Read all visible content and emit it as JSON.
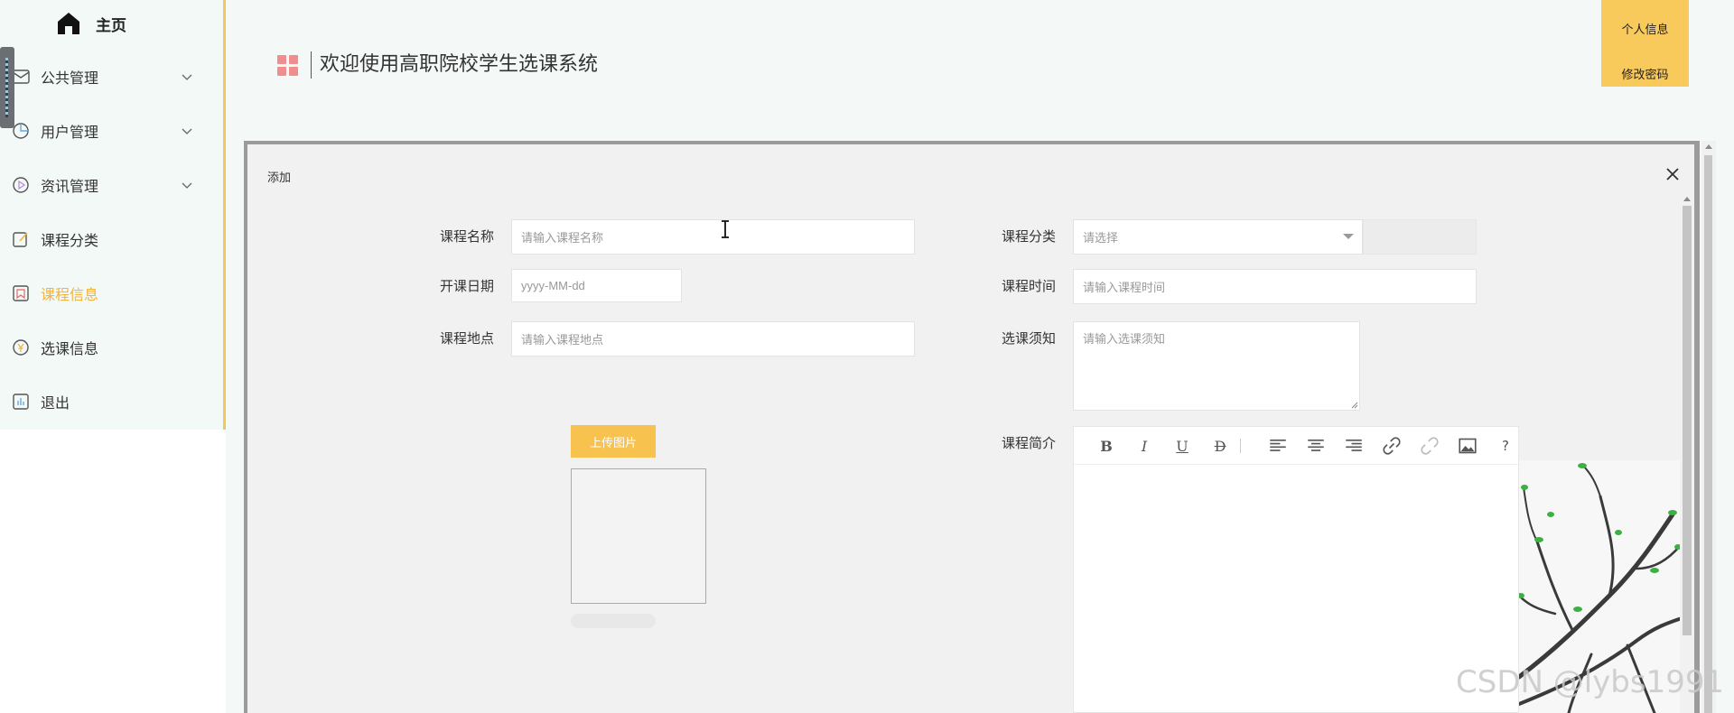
{
  "sidebar": {
    "home_label": "主页",
    "items": [
      {
        "label": "公共管理",
        "icon": "mail-icon"
      },
      {
        "label": "用户管理",
        "icon": "pie-chart-icon"
      },
      {
        "label": "资讯管理",
        "icon": "play-circle-icon"
      },
      {
        "label": "课程分类",
        "icon": "edit-icon"
      },
      {
        "label": "课程信息",
        "icon": "bookmark-icon",
        "active": true
      },
      {
        "label": "选课信息",
        "icon": "yen-circle-icon"
      },
      {
        "label": "退出",
        "icon": "bar-chart-icon"
      }
    ]
  },
  "header": {
    "title": "欢迎使用高职院校学生选课系统",
    "profile_label": "个人信息",
    "change_password_label": "修改密码"
  },
  "modal": {
    "title": "添加",
    "fields": {
      "course_name": {
        "label": "课程名称",
        "placeholder": "请输入课程名称"
      },
      "course_category": {
        "label": "课程分类",
        "placeholder": "请选择"
      },
      "start_date": {
        "label": "开课日期",
        "placeholder": "yyyy-MM-dd"
      },
      "course_time": {
        "label": "课程时间",
        "placeholder": "请输入课程时间"
      },
      "course_location": {
        "label": "课程地点",
        "placeholder": "请输入课程地点"
      },
      "enroll_notice": {
        "label": "选课须知",
        "placeholder": "请输入选课须知"
      },
      "course_intro": {
        "label": "课程简介"
      }
    },
    "upload_label": "上传图片",
    "editor_toolbar": [
      "bold-icon",
      "italic-icon",
      "underline-icon",
      "strikethrough-icon",
      "align-left-icon",
      "align-center-icon",
      "align-right-icon",
      "link-icon",
      "unlink-icon",
      "image-icon",
      "help-icon"
    ]
  },
  "watermark": "CSDN @lybs1991",
  "colors": {
    "accent": "#f8c95b",
    "active_nav": "#f2b33f",
    "logo_tile": "#f08e8e",
    "sidebar_bg": "#f3f9f7"
  }
}
